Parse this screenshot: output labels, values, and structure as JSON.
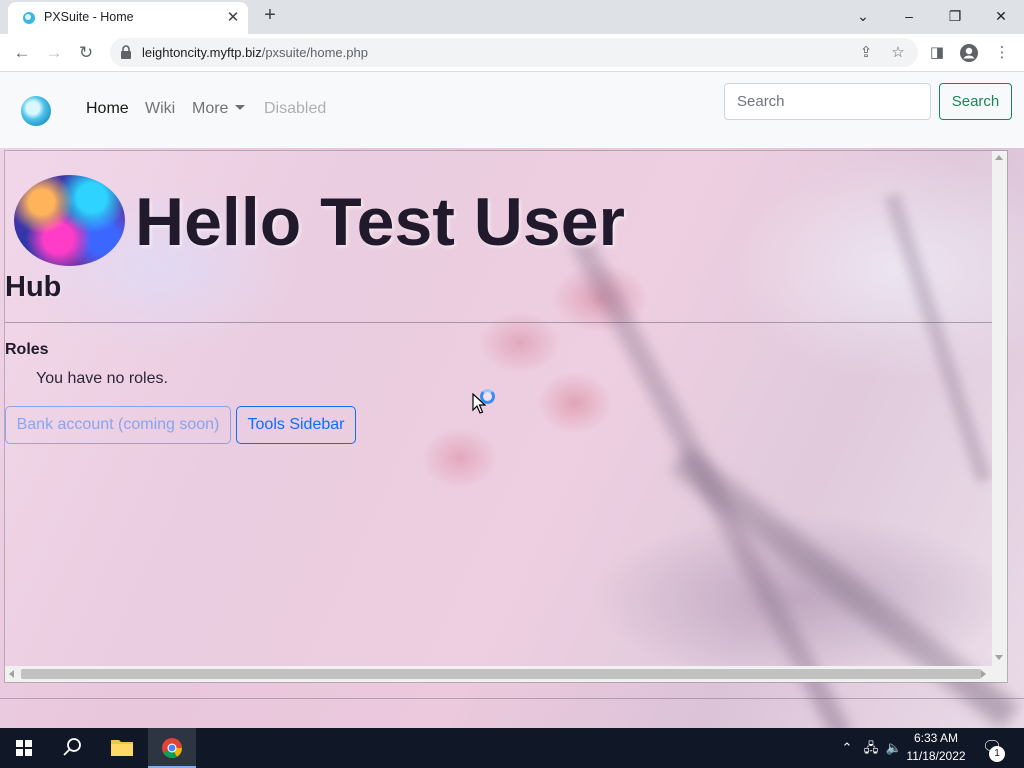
{
  "browser": {
    "tab_title": "PXSuite - Home",
    "url_host": "leightoncity.myftp.biz",
    "url_path": "/pxsuite/home.php",
    "icons": [
      "back-icon",
      "forward-icon",
      "reload-icon",
      "lock-icon",
      "share-icon",
      "bookmark-star-icon",
      "side-panel-icon",
      "profile-icon",
      "menu-dots-icon"
    ]
  },
  "navbar": {
    "links": [
      "Home",
      "Wiki",
      "More",
      "Disabled"
    ],
    "search_placeholder": "Search",
    "search_button": "Search"
  },
  "hub": {
    "greeting": "Hello Test User",
    "section_title": "Hub",
    "roles_label": "Roles",
    "roles_empty": "You have no roles.",
    "bank_button": "Bank account (coming soon)",
    "tools_button": "Tools Sidebar"
  },
  "taskbar": {
    "time": "6:33 AM",
    "date": "11/18/2022",
    "notification_count": "1"
  },
  "colors": {
    "primary": "#0d6efd",
    "success": "#198754",
    "taskbar": "#101828"
  }
}
